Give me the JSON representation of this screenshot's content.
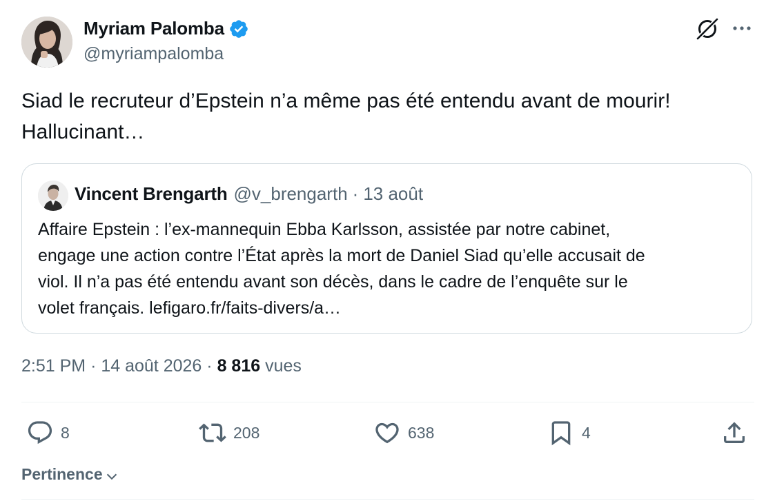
{
  "author": {
    "name": "Myriam Palomba",
    "handle": "@myriampalomba",
    "verified": true
  },
  "tweet": {
    "text_lines": [
      "Siad le recruteur d’Epstein n’a même pas été entendu avant de mourir!",
      "Hallucinant…"
    ]
  },
  "quote": {
    "name": "Vincent Brengarth",
    "handle": "@v_brengarth",
    "separator": "·",
    "date": "13 août",
    "text_lines": [
      "Affaire Epstein : l’ex-mannequin Ebba Karlsson, assistée par notre cabinet,",
      "engage une action contre l’État après la mort de Daniel Siad qu’elle accusait de",
      "viol. Il n’a pas été entendu avant son décès, dans le cadre de l’enquête sur le",
      "volet français. lefigaro.fr/faits-divers/a…"
    ]
  },
  "meta": {
    "time": "2:51 PM",
    "separator": "·",
    "date": "14 août 2026",
    "views_count": "8 816",
    "views_label": "vues"
  },
  "actions": {
    "replies": "8",
    "reposts": "208",
    "likes": "638",
    "bookmarks": "4"
  },
  "sort": {
    "label": "Pertinence"
  },
  "icons": {
    "verified": "verified-badge-icon",
    "grok": "grok-icon",
    "more": "more-icon",
    "reply": "reply-icon",
    "repost": "repost-icon",
    "like": "heart-icon",
    "bookmark": "bookmark-icon",
    "share": "share-icon",
    "sort": "chevron-down-icon"
  },
  "colors": {
    "text": "#0f1419",
    "secondary": "#536471",
    "verified": "#1d9bf0",
    "border": "#cfd9de",
    "divider": "#eff3f4"
  }
}
